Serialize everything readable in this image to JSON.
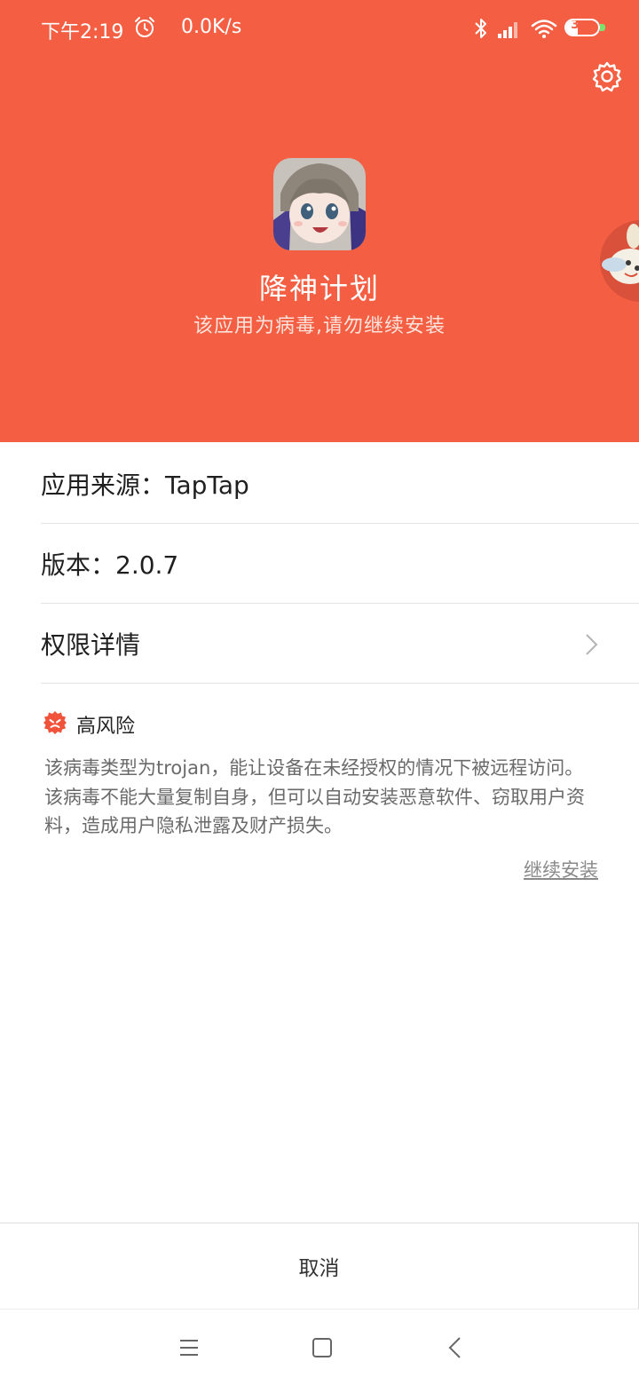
{
  "status_bar": {
    "time": "下午2:19",
    "net_speed": "0.0K/s",
    "battery_level": "35",
    "battery_fraction": 0.35,
    "icons": [
      "alarm-icon",
      "bluetooth-icon",
      "signal-icon",
      "wifi-icon",
      "battery-icon"
    ]
  },
  "header": {
    "app_name": "降神计划",
    "warning": "该应用为病毒,请勿继续安装",
    "icons": [
      "settings-icon",
      "app-icon"
    ]
  },
  "details": {
    "source": "应用来源：TapTap",
    "version": "版本：2.0.7",
    "permissions": "权限详情"
  },
  "risk": {
    "level": "高风险",
    "description": "该病毒类型为trojan，能让设备在未经授权的情况下被远程访问。该病毒不能大量复制自身，但可以自动安装恶意软件、窃取用户资料，造成用户隐私泄露及财产损失。",
    "continue_label": "继续安装"
  },
  "actions": {
    "cancel_label": "取消"
  },
  "navigation": {
    "icons": [
      "menu-icon",
      "home-icon",
      "back-icon"
    ]
  },
  "colors": {
    "header_bg": "#f45f43",
    "risk_red": "#f0533a",
    "battery_green": "#7be36c"
  }
}
